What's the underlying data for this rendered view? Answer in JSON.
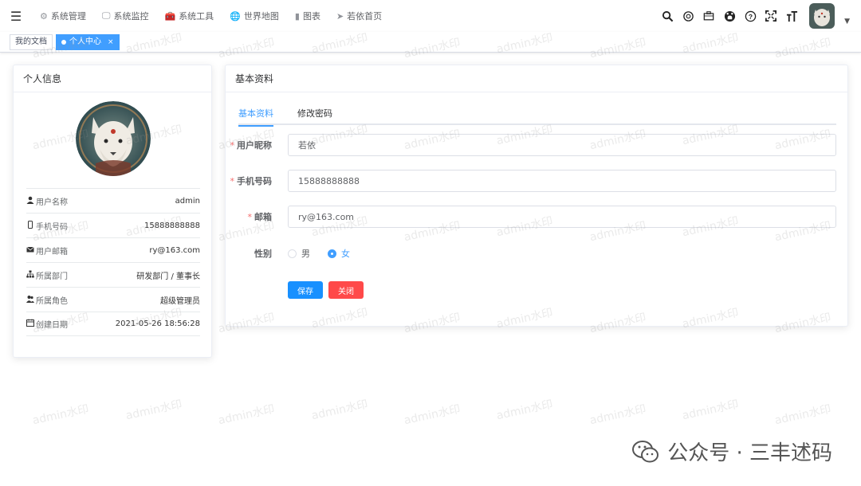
{
  "navbar": {
    "menu": [
      {
        "icon": "gear-icon",
        "glyph": "⚙",
        "label": "系统管理"
      },
      {
        "icon": "monitor-icon",
        "glyph": "🖵",
        "label": "系统监控"
      },
      {
        "icon": "toolbox-icon",
        "glyph": "🧰",
        "label": "系统工具"
      },
      {
        "icon": "globe-icon",
        "glyph": "🌐",
        "label": "世界地图"
      },
      {
        "icon": "bar-chart-icon",
        "glyph": "▮",
        "label": "图表"
      },
      {
        "icon": "send-icon",
        "glyph": "➤",
        "label": "若依首页"
      }
    ]
  },
  "tags": {
    "doc": "我的文档",
    "profile": "个人中心",
    "close": "×"
  },
  "left_card": {
    "title": "个人信息",
    "rows": [
      {
        "icon": "user-icon",
        "glyph": "👤",
        "key": "用户名称",
        "value": "admin"
      },
      {
        "icon": "phone-icon",
        "glyph": "▯",
        "key": "手机号码",
        "value": "15888888888"
      },
      {
        "icon": "mail-icon",
        "glyph": "✉",
        "key": "用户邮箱",
        "value": "ry@163.com"
      },
      {
        "icon": "tree-icon",
        "glyph": "⛬",
        "key": "所属部门",
        "value": "研发部门 / 董事长"
      },
      {
        "icon": "peoples-icon",
        "glyph": "👥",
        "key": "所属角色",
        "value": "超级管理员"
      },
      {
        "icon": "date-icon",
        "glyph": "▤",
        "key": "创建日期",
        "value": "2021-05-26 18:56:28"
      }
    ]
  },
  "right_card": {
    "title": "基本资料",
    "tabs": [
      "基本资料",
      "修改密码"
    ],
    "form": {
      "nickname_label": "用户昵称",
      "nickname": "若依",
      "phone_label": "手机号码",
      "phone": "15888888888",
      "email_label": "邮箱",
      "email": "ry@163.com",
      "sex_label": "性别",
      "sex_options": [
        "男",
        "女"
      ],
      "required_mark": "*"
    },
    "save": "保存",
    "close": "关闭"
  },
  "watermark": "admin水印",
  "brand": {
    "text": "公众号 · 三丰述码"
  },
  "colors": {
    "primary": "#409eff",
    "danger": "#ff4949",
    "required": "#f56c6c"
  }
}
